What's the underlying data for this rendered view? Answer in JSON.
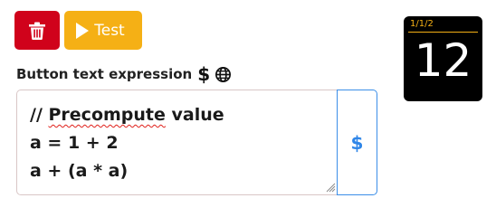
{
  "toolbar": {
    "delete_icon": "trash-icon",
    "test_label": "Test",
    "test_icon": "play-icon",
    "colors": {
      "delete": "#d0021b",
      "test": "#f5b015"
    }
  },
  "expression": {
    "label": "Button text expression",
    "label_dollar": "$",
    "label_globe_icon": "globe-icon",
    "lines": [
      "// Precompute value",
      "a = 1 + 2",
      "a + (a * a)"
    ],
    "side_button_label": "$",
    "colors": {
      "border": "#d9c6c6",
      "side_button_border": "#3b8ee8",
      "side_button_text": "#2f86e8",
      "spellcheck_underline": "#e0201a"
    }
  },
  "preview_tile": {
    "coordinate": "1/1/2",
    "value": "12",
    "colors": {
      "background": "#000000",
      "accent": "#f5b015",
      "text": "#ffffff"
    }
  }
}
